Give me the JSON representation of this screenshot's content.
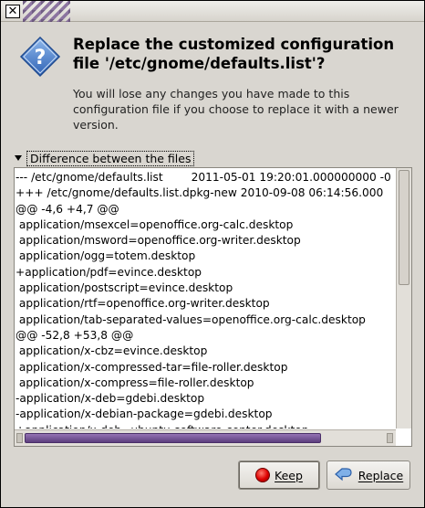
{
  "window": {
    "close_glyph": "✕"
  },
  "dialog": {
    "icon": "question-icon",
    "heading": "Replace the customized configuration file '/etc/gnome/defaults.list'?",
    "message": "You will lose any changes you have made to this configuration file if you choose to replace it with a newer version."
  },
  "expander": {
    "label": "Difference between the files",
    "expanded": true
  },
  "diff": {
    "lines": [
      "--- /etc/gnome/defaults.list        2011-05-01 19:20:01.000000000 -0",
      "+++ /etc/gnome/defaults.list.dpkg-new 2010-09-08 06:14:56.000",
      "@@ -4,6 +4,7 @@",
      " application/msexcel=openoffice.org-calc.desktop",
      " application/msword=openoffice.org-writer.desktop",
      " application/ogg=totem.desktop",
      "+application/pdf=evince.desktop",
      " application/postscript=evince.desktop",
      " application/rtf=openoffice.org-writer.desktop",
      " application/tab-separated-values=openoffice.org-calc.desktop",
      "@@ -52,8 +53,8 @@",
      " application/x-cbz=evince.desktop",
      " application/x-compressed-tar=file-roller.desktop",
      " application/x-compress=file-roller.desktop",
      "-application/x-deb=gdebi.desktop",
      "-application/x-debian-package=gdebi.desktop",
      "+application/x-deb=ubuntu-software-center.desktop"
    ]
  },
  "buttons": {
    "keep": "Keep",
    "replace": "Replace"
  },
  "colors": {
    "scrollbar_thumb": "#7b5a9c",
    "keep_icon": "#dd0000",
    "replace_icon": "#3d7fd0"
  }
}
